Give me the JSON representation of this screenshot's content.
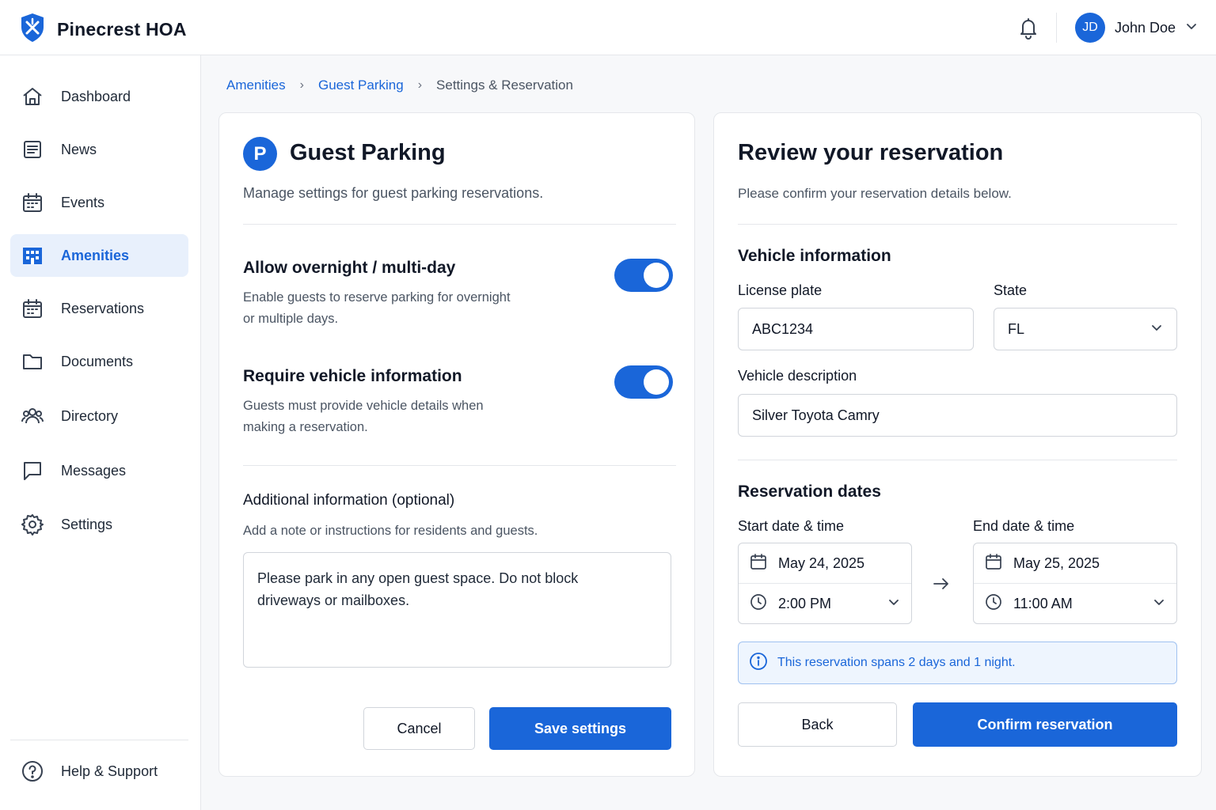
{
  "app": {
    "name": "Pinecrest HOA"
  },
  "user": {
    "initials": "JD",
    "name": "John Doe"
  },
  "sidebar": {
    "items": [
      {
        "label": "Dashboard",
        "icon": "home-icon"
      },
      {
        "label": "News",
        "icon": "news-icon"
      },
      {
        "label": "Events",
        "icon": "calendar-icon"
      },
      {
        "label": "Amenities",
        "icon": "building-icon",
        "active": true
      },
      {
        "label": "Reservations",
        "icon": "calendar-icon"
      },
      {
        "label": "Documents",
        "icon": "folder-icon"
      },
      {
        "label": "Directory",
        "icon": "people-icon"
      },
      {
        "label": "Messages",
        "icon": "message-icon"
      },
      {
        "label": "Settings",
        "icon": "gear-icon"
      }
    ],
    "help": {
      "label": "Help & Support",
      "icon": "help-icon"
    }
  },
  "breadcrumb": {
    "items": [
      "Amenities",
      "Guest Parking"
    ],
    "current": "Settings & Reservation"
  },
  "settings": {
    "badge": "P",
    "title": "Guest Parking",
    "subtitle": "Manage settings for guest parking reservations.",
    "overnight": {
      "title": "Allow overnight / multi-day",
      "desc_line1": "Enable guests to reserve parking for overnight",
      "desc_line2": "or multiple days.",
      "enabled": true
    },
    "vehicle_required": {
      "title": "Require vehicle information",
      "desc_line1": "Guests must provide vehicle details when",
      "desc_line2": "making a reservation.",
      "enabled": true
    },
    "additional": {
      "title": "Additional information (optional)",
      "hint": "Add a note or instructions for residents and guests.",
      "note_line1": "Please park in any open guest space. Do not block",
      "note_line2": "driveways or mailboxes."
    },
    "cancel_label": "Cancel",
    "save_label": "Save settings"
  },
  "review": {
    "title": "Review your reservation",
    "subtitle": "Please confirm your reservation details below.",
    "vehicle": {
      "heading": "Vehicle information",
      "plate_label": "License plate",
      "plate_value": "ABC1234",
      "state_label": "State",
      "state_value": "FL",
      "desc_label": "Vehicle description",
      "desc_value": "Silver Toyota Camry"
    },
    "dates": {
      "heading": "Reservation dates",
      "start_label": "Start date & time",
      "start_date": "May 24, 2025",
      "start_time": "2:00 PM",
      "end_label": "End date & time",
      "end_date": "May 25, 2025",
      "end_time": "11:00 AM"
    },
    "info": "This reservation spans 2 days and 1 night.",
    "back_label": "Back",
    "confirm_label": "Confirm reservation"
  },
  "colors": {
    "accent": "#1a66d9",
    "info_bg": "#eef5fe",
    "border": "#e5e7eb"
  }
}
